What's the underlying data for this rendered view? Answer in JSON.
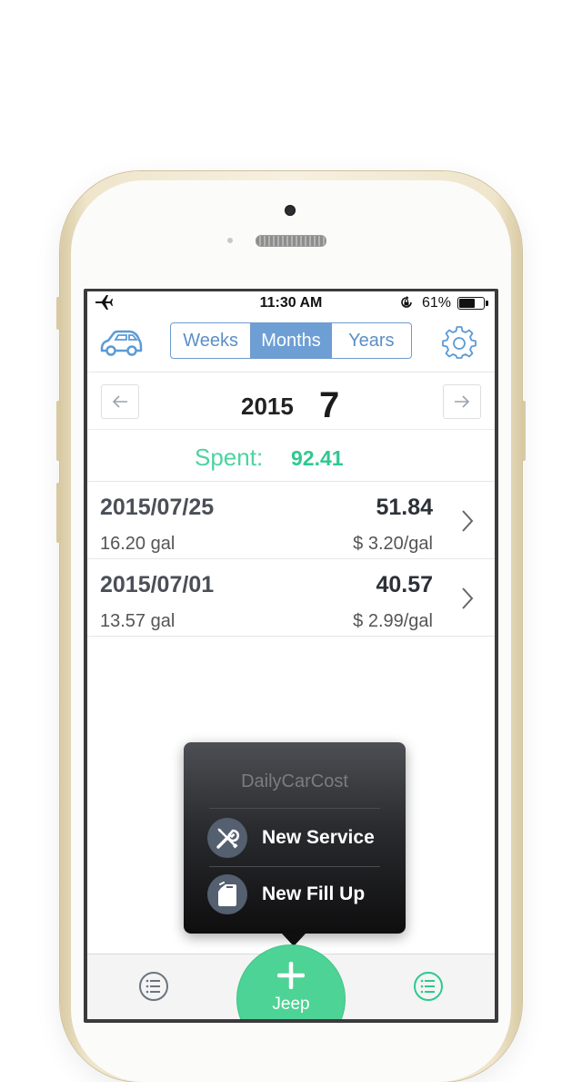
{
  "status_bar": {
    "time": "11:30 AM",
    "battery_percent": "61%",
    "battery_level": 0.61
  },
  "nav": {
    "segments": [
      "Weeks",
      "Months",
      "Years"
    ],
    "selected_segment": "Months",
    "icons": {
      "left": "car-icon",
      "right": "gear-icon"
    }
  },
  "period": {
    "year": "2015",
    "month": "7"
  },
  "summary": {
    "spent_label": "Spent:",
    "spent_value": "92.41"
  },
  "entries": [
    {
      "date": "2015/07/25",
      "total": "51.84",
      "gallons": "16.20 gal",
      "price": "$ 3.20/gal"
    },
    {
      "date": "2015/07/01",
      "total": "40.57",
      "gallons": "13.57 gal",
      "price": "$ 2.99/gal"
    }
  ],
  "popup": {
    "title": "DailyCarCost",
    "items": [
      {
        "label": "New Service",
        "icon": "wrench-screwdriver-icon"
      },
      {
        "label": "New Fill Up",
        "icon": "fuel-can-icon"
      }
    ]
  },
  "tabbar": {
    "fab_label": "Jeep"
  },
  "colors": {
    "accent_blue": "#6d9fd5",
    "accent_green": "#4dd395",
    "spent_green": "#2fc890"
  }
}
